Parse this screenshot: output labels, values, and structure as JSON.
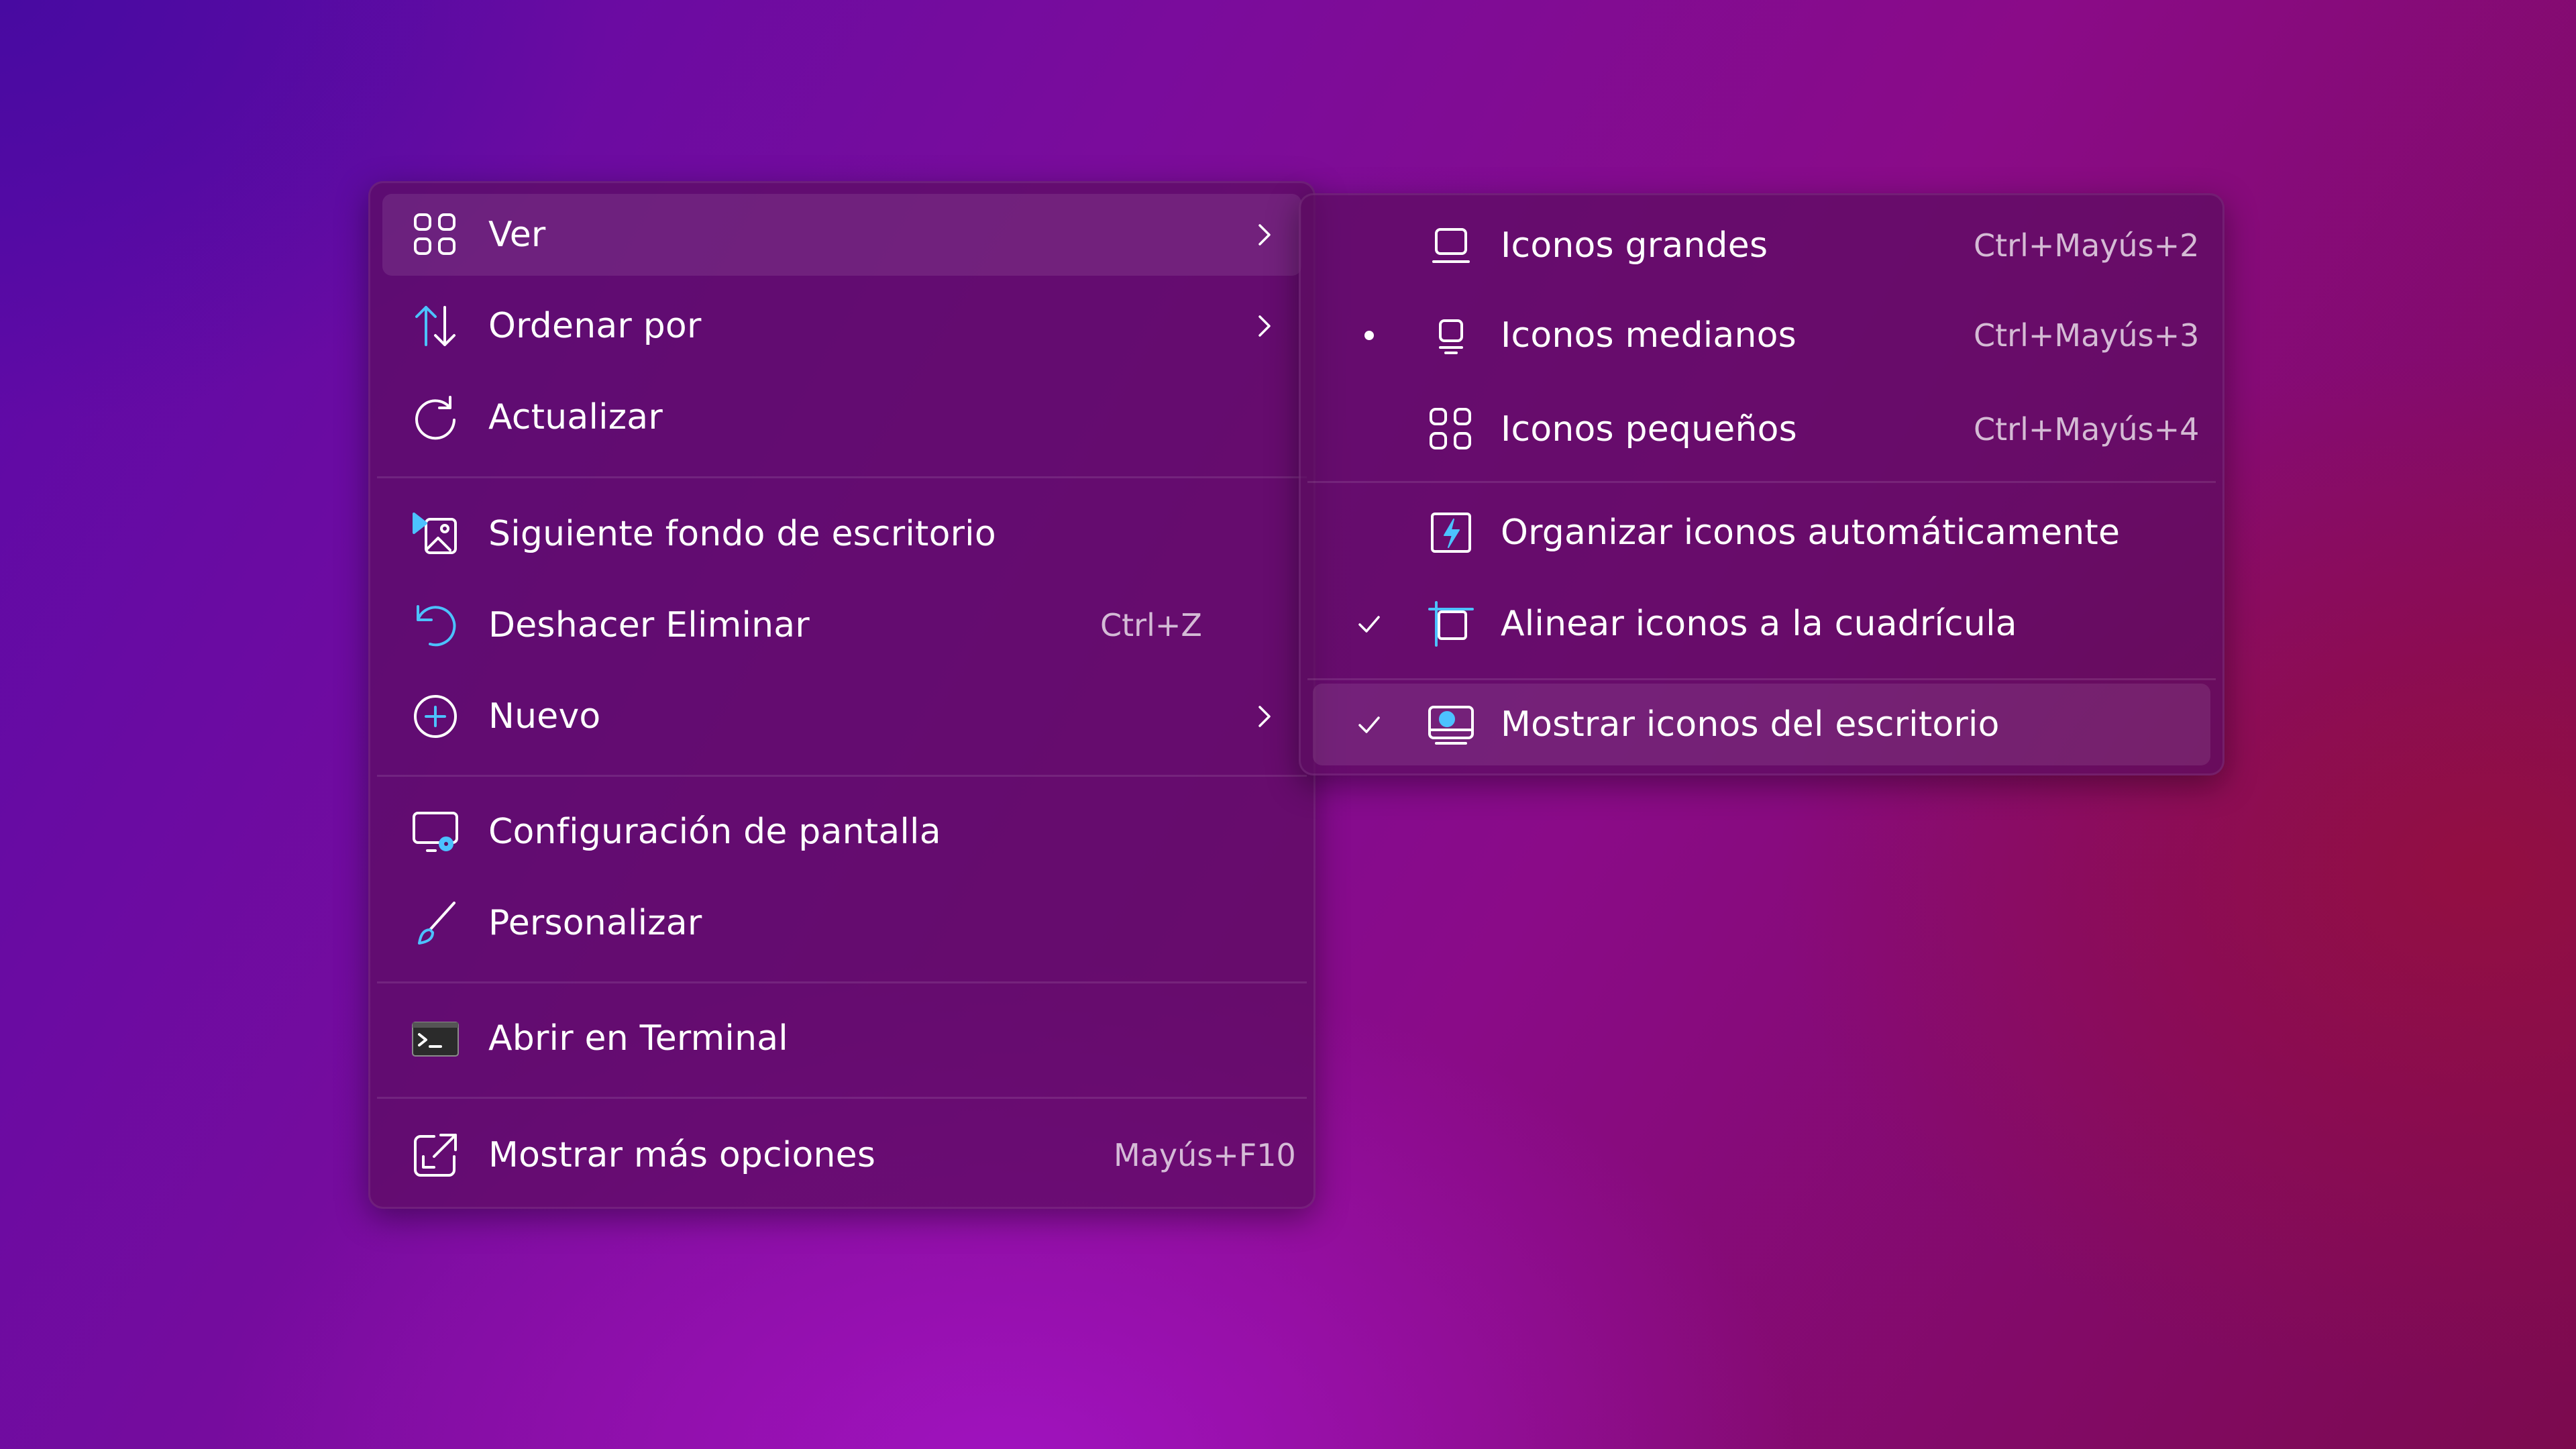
{
  "main_menu": {
    "items": [
      {
        "label": "Ver"
      },
      {
        "label": "Ordenar por"
      },
      {
        "label": "Actualizar"
      },
      {
        "label": "Siguiente fondo de escritorio"
      },
      {
        "label": "Deshacer Eliminar",
        "shortcut": "Ctrl+Z"
      },
      {
        "label": "Nuevo"
      },
      {
        "label": "Configuración de pantalla"
      },
      {
        "label": "Personalizar"
      },
      {
        "label": "Abrir en Terminal"
      },
      {
        "label": "Mostrar más opciones",
        "shortcut": "Mayús+F10"
      }
    ]
  },
  "view_submenu": {
    "items": [
      {
        "label": "Iconos grandes",
        "shortcut": "Ctrl+Mayús+2"
      },
      {
        "label": "Iconos medianos",
        "shortcut": "Ctrl+Mayús+3",
        "selected": true
      },
      {
        "label": "Iconos pequeños",
        "shortcut": "Ctrl+Mayús+4"
      },
      {
        "label": "Organizar iconos automáticamente",
        "checked": false
      },
      {
        "label": "Alinear iconos a la cuadrícula",
        "checked": true
      },
      {
        "label": "Mostrar iconos del escritorio",
        "checked": true
      }
    ]
  },
  "colors": {
    "accent": "#4cc2ff",
    "menu_background": "#5c0c60",
    "text": "#ffffff"
  }
}
